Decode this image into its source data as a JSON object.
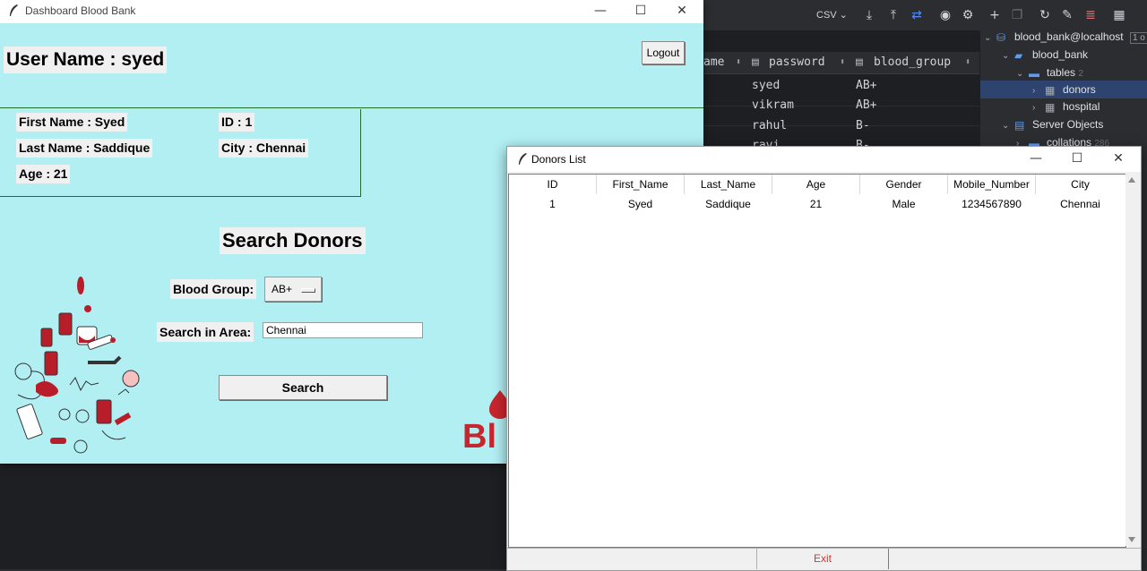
{
  "ide": {
    "toolbar": {
      "csv_label": "CSV ⌄"
    },
    "grid": {
      "columns": [
        {
          "label": "ame"
        },
        {
          "label": "password"
        },
        {
          "label": "blood_group"
        }
      ],
      "rows": [
        {
          "password": "syed",
          "blood_group": "AB+"
        },
        {
          "password": "vikram",
          "blood_group": "AB+"
        },
        {
          "password": "rahul",
          "blood_group": "B-"
        },
        {
          "password": "ravi",
          "blood_group": "B-"
        }
      ]
    },
    "tree": {
      "connection": "blood_bank@localhost",
      "connection_suffix": "1 o",
      "database": "blood_bank",
      "tables": "tables",
      "tables_count": "2",
      "donors": "donors",
      "hospital": "hospital",
      "server_objects": "Server Objects",
      "collations": "collations",
      "collations_count": "286"
    }
  },
  "dashboard": {
    "window_title": "Dashboard Blood Bank",
    "user_label": "User Name : syed",
    "logout_label": "Logout",
    "first_name": "First Name : Syed",
    "last_name": "Last Name : Saddique",
    "age": "Age : 21",
    "id": "ID : 1",
    "city": "City : Chennai",
    "search_title": "Search Donors",
    "blood_group_label": "Blood Group:",
    "blood_group_value": "AB+",
    "area_label": "Search in Area:",
    "area_value": "Chennai",
    "search_button": "Search",
    "logo_text": "Bl"
  },
  "donors_window": {
    "title": "Donors List",
    "columns": [
      "ID",
      "First_Name",
      "Last_Name",
      "Age",
      "Gender",
      "Mobile_Number",
      "City"
    ],
    "rows": [
      [
        "1",
        "Syed",
        "Saddique",
        "21",
        "Male",
        "1234567890",
        "Chennai"
      ]
    ],
    "exit_label": "Exit"
  },
  "colors": {
    "window_bg": "#b2eff3",
    "accent_red": "#c8262e",
    "exit_text": "#e03030"
  }
}
